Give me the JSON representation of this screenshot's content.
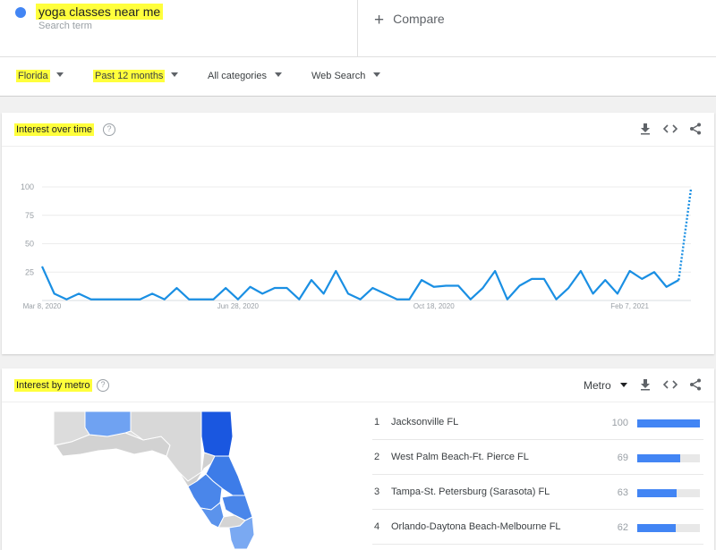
{
  "search": {
    "term": "yoga classes near me",
    "term_sub": "Search term",
    "compare": "Compare",
    "term_color": "#4285f4"
  },
  "filters": {
    "region": "Florida",
    "time": "Past 12 months",
    "category": "All categories",
    "source": "Web Search"
  },
  "interest_over_time": {
    "title": "Interest over time",
    "help": "?"
  },
  "interest_by_metro": {
    "title": "Interest by metro",
    "help": "?",
    "select": "Metro",
    "rankings": [
      {
        "rank": "1",
        "name": "Jacksonville FL",
        "value": "100",
        "score": 100
      },
      {
        "rank": "2",
        "name": "West Palm Beach-Ft. Pierce FL",
        "value": "69",
        "score": 69
      },
      {
        "rank": "3",
        "name": "Tampa-St. Petersburg (Sarasota) FL",
        "value": "63",
        "score": 63
      },
      {
        "rank": "4",
        "name": "Orlando-Daytona Beach-Melbourne FL",
        "value": "62",
        "score": 62
      }
    ]
  },
  "icons": [
    "download-icon",
    "embed-icon",
    "share-icon",
    "help-icon"
  ],
  "highlight_color": "#ffff3c",
  "chart_data": {
    "type": "line",
    "yticks": [
      "100",
      "75",
      "50",
      "25"
    ],
    "ylim": [
      0,
      100
    ],
    "xticks": [
      {
        "label": "Mar 8, 2020",
        "index": 0
      },
      {
        "label": "Jun 28, 2020",
        "index": 16
      },
      {
        "label": "Oct 18, 2020",
        "index": 32
      },
      {
        "label": "Feb 7, 2021",
        "index": 48
      }
    ],
    "series": [
      {
        "color": "#1a8fe3",
        "values": [
          30,
          6,
          1,
          6,
          1,
          1,
          1,
          1,
          1,
          6,
          1,
          11,
          1,
          1,
          1,
          11,
          1,
          12,
          6,
          11,
          11,
          1,
          18,
          6,
          26,
          6,
          1,
          11,
          6,
          1,
          1,
          18,
          12,
          13,
          13,
          1,
          11,
          26,
          1,
          13,
          19,
          19,
          1,
          11,
          26,
          6,
          18,
          6,
          26,
          19,
          25,
          12,
          18
        ],
        "partial_from_index": 51,
        "partial_values": [
          18,
          98
        ]
      }
    ]
  }
}
